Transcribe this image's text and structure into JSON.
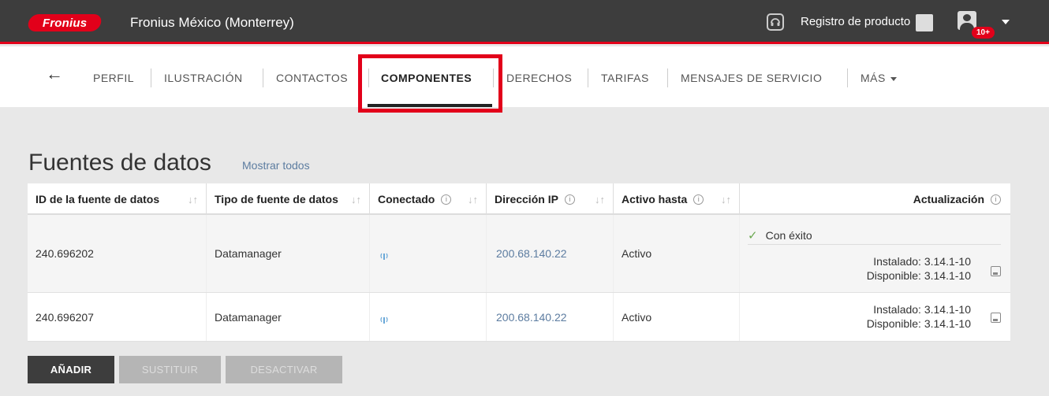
{
  "header": {
    "logo_text": "Fronius",
    "site_title": "Fronius México (Monterrey)",
    "register_label": "Registro de producto",
    "notifications_badge": "10+",
    "brand_color": "#e2001a"
  },
  "tabs": {
    "items": [
      {
        "label": "PERFIL"
      },
      {
        "label": "ILUSTRACIÓN"
      },
      {
        "label": "CONTACTOS"
      },
      {
        "label": "COMPONENTES"
      },
      {
        "label": "DERECHOS"
      },
      {
        "label": "TARIFAS"
      },
      {
        "label": "MENSAJES DE SERVICIO"
      },
      {
        "label": "MÁS"
      }
    ],
    "active": "COMPONENTES"
  },
  "section": {
    "title": "Fuentes de datos",
    "show_all": "Mostrar todos"
  },
  "table": {
    "columns": [
      "ID de la fuente de datos",
      "Tipo de fuente de datos",
      "Conectado",
      "Dirección IP",
      "Activo hasta",
      "Actualización"
    ],
    "rows": [
      {
        "id": "240.696202",
        "type": "Datamanager",
        "ip": "200.68.140.22",
        "active": "Activo",
        "update_status": "Con éxito",
        "installed": "Instalado: 3.14.1-10",
        "available": "Disponible: 3.14.1-10"
      },
      {
        "id": "240.696207",
        "type": "Datamanager",
        "ip": "200.68.140.22",
        "active": "Activo",
        "installed": "Instalado: 3.14.1-10",
        "available": "Disponible: 3.14.1-10"
      }
    ]
  },
  "buttons": {
    "add": "AÑADIR",
    "replace": "SUSTITUIR",
    "deactivate": "DESACTIVAR"
  }
}
